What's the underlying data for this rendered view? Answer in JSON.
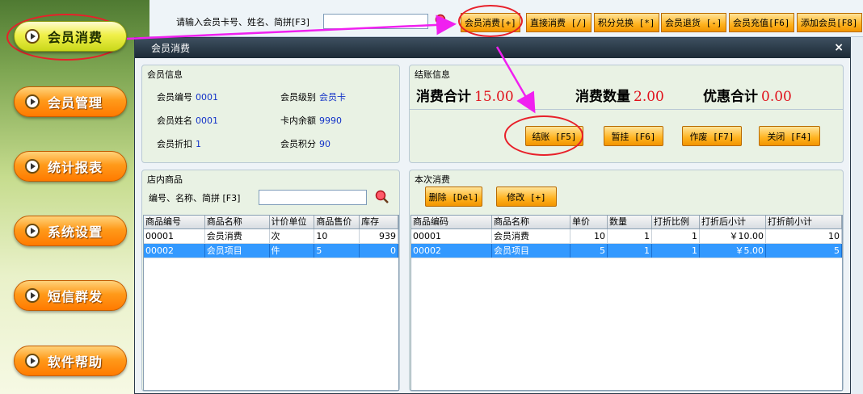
{
  "sidebar": {
    "items": [
      {
        "label": "会员消费"
      },
      {
        "label": "会员管理"
      },
      {
        "label": "统计报表"
      },
      {
        "label": "系统设置"
      },
      {
        "label": "短信群发"
      },
      {
        "label": "软件帮助"
      }
    ]
  },
  "topbar": {
    "search_label": "请输入会员卡号、姓名、简拼[F3]",
    "search_value": "",
    "buttons": [
      {
        "label": "会员消费[+]"
      },
      {
        "label": "直接消费 [/]"
      },
      {
        "label": "积分兑换 [*]"
      },
      {
        "label": "会员退货 [-]"
      },
      {
        "label": "会员充值[F6]"
      },
      {
        "label": "添加会员[F8]"
      }
    ]
  },
  "dialog": {
    "title": "会员消费",
    "member_info": {
      "title": "会员信息",
      "fields": [
        {
          "label": "会员编号",
          "value": "0001"
        },
        {
          "label": "会员级别",
          "value": "会员卡"
        },
        {
          "label": "会员姓名",
          "value": "0001"
        },
        {
          "label": "卡内余额",
          "value": "9990"
        },
        {
          "label": "会员折扣",
          "value": "1"
        },
        {
          "label": "会员积分",
          "value": "90"
        }
      ]
    },
    "checkout": {
      "title": "结账信息",
      "total_label": "消费合计",
      "total_value": "15.00",
      "qty_label": "消费数量",
      "qty_value": "2.00",
      "discount_label": "优惠合计",
      "discount_value": "0.00",
      "buttons": [
        {
          "label": "结账 [F5]"
        },
        {
          "label": "暂挂 [F6]"
        },
        {
          "label": "作废 [F7]"
        },
        {
          "label": "关闭 [F4]"
        }
      ]
    },
    "store_products": {
      "title": "店内商品",
      "search_label": "编号、名称、简拼 [F3]",
      "search_value": "",
      "columns": [
        "商品编号",
        "商品名称",
        "计价单位",
        "商品售价",
        "库存"
      ],
      "rows": [
        [
          "00001",
          "会员消费",
          "次",
          "10",
          "939"
        ],
        [
          "00002",
          "会员项目",
          "件",
          "5",
          "0"
        ]
      ]
    },
    "current_consumption": {
      "title": "本次消费",
      "delete_label": "删除 [Del]",
      "edit_label": "修改 [+]",
      "columns": [
        "商品编码",
        "商品名称",
        "单价",
        "数量",
        "打折比例",
        "打折后小计",
        "打折前小计"
      ],
      "rows": [
        [
          "00001",
          "会员消费",
          "10",
          "1",
          "1",
          "￥10.00",
          "10"
        ],
        [
          "00002",
          "会员项目",
          "5",
          "1",
          "1",
          "￥5.00",
          "5"
        ]
      ]
    }
  }
}
